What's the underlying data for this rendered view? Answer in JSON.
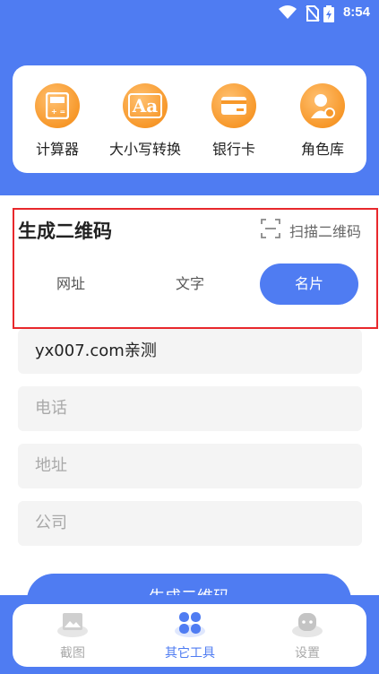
{
  "status_bar": {
    "time": "8:54"
  },
  "tools": [
    {
      "label": "计算器",
      "icon": "calculator-icon"
    },
    {
      "label": "大小写转换",
      "icon": "letter-case-icon",
      "glyph": "Aa"
    },
    {
      "label": "银行卡",
      "icon": "bank-card-icon"
    },
    {
      "label": "角色库",
      "icon": "person-icon"
    }
  ],
  "qr": {
    "title": "生成二维码",
    "scan_label": "扫描二维码",
    "tabs": [
      {
        "label": "网址"
      },
      {
        "label": "文字"
      },
      {
        "label": "名片"
      }
    ],
    "active_tab": "名片"
  },
  "form": {
    "name_value": "yx007.com亲测",
    "phone_placeholder": "电话",
    "address_placeholder": "地址",
    "company_placeholder": "公司",
    "generate_label": "生成二维码"
  },
  "bottom_nav": [
    {
      "label": "截图",
      "icon": "screenshot-icon"
    },
    {
      "label": "其它工具",
      "icon": "other-tools-icon"
    },
    {
      "label": "设置",
      "icon": "settings-icon"
    }
  ],
  "colors": {
    "primary": "#4f7cf2",
    "accent": "#f7982a",
    "highlight": "#e8282c"
  }
}
